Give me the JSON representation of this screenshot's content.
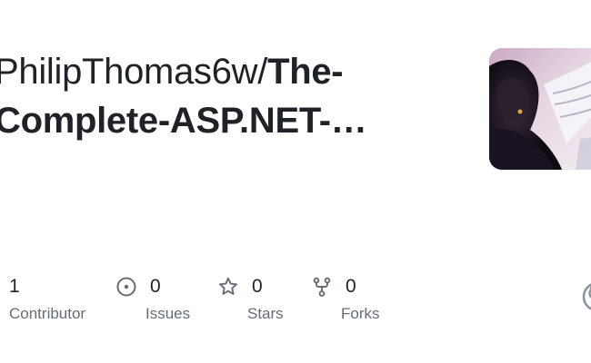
{
  "repo": {
    "owner": "PhilipThomas6w/",
    "name": "The-Complete-ASP.NET-…"
  },
  "avatar": {
    "icon": "avatar-artwork",
    "alt": ""
  },
  "stats": {
    "contributors": {
      "count": "1",
      "label": "Contributor"
    },
    "issues": {
      "count": "0",
      "label": "Issues",
      "icon": "issue-opened-icon"
    },
    "stars": {
      "count": "0",
      "label": "Stars",
      "icon": "star-icon"
    },
    "forks": {
      "count": "0",
      "label": "Forks",
      "icon": "repo-forked-icon"
    }
  },
  "brand": {
    "icon": "github-mark-icon",
    "color": "#8c959f"
  },
  "colors": {
    "text": "#1f2328",
    "muted": "#656d76",
    "icon": "#656d76"
  }
}
